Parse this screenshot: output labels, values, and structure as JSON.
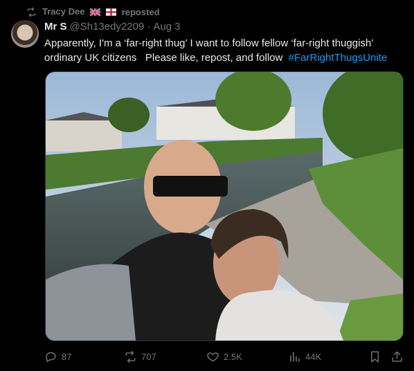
{
  "repost": {
    "icon": "repost-icon",
    "reposter_name": "Tracy Dee",
    "label": "reposted"
  },
  "tweet": {
    "display_name": "Mr S",
    "handle": "@Sh13edy2209",
    "separator": "·",
    "date": "Aug 3",
    "text_line1": "Apparently, I'm a ‘far-right thug’   I want to follow fellow ‘far-right thuggish’",
    "text_line2": "ordinary UK citizens   Please like, repost, and follow  ",
    "hashtag": "#FarRightThugsUnite"
  },
  "actions": {
    "replies": "87",
    "reposts": "707",
    "likes": "2.5K",
    "views": "44K"
  },
  "colors": {
    "background": "#000000",
    "text": "#e7e9ea",
    "muted": "#71767b",
    "link": "#1d9bf0"
  }
}
